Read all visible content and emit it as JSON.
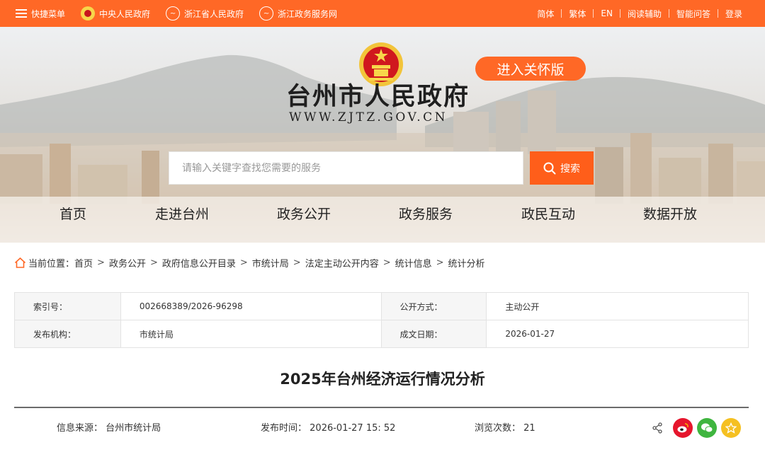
{
  "topbar": {
    "quick_menu": "快捷菜单",
    "links": [
      "中央人民政府",
      "浙江省人民政府",
      "浙江政务服务网"
    ],
    "right_links": [
      "简体",
      "繁体",
      "EN",
      "阅读辅助",
      "智能问答",
      "登录"
    ]
  },
  "banner": {
    "care_version": "进入关怀版",
    "site_title": "台州市人民政府",
    "site_url": "WWW.ZJTZ.GOV.CN",
    "search_placeholder": "请输入关键字查找您需要的服务",
    "search_button": "搜索"
  },
  "nav": [
    "首页",
    "走进台州",
    "政务公开",
    "政务服务",
    "政民互动",
    "数据开放"
  ],
  "breadcrumb": {
    "prefix": "当前位置：",
    "items": [
      "首页",
      "政务公开",
      "政府信息公开目录",
      "市统计局",
      "法定主动公开内容",
      "统计信息",
      "统计分析"
    ],
    "sep": ">"
  },
  "meta": {
    "index_label": "索引号：",
    "index_value": "002668389/2026-96298",
    "open_label": "公开方式：",
    "open_value": "主动公开",
    "org_label": "发布机构：",
    "org_value": "市统计局",
    "date_label": "成文日期：",
    "date_value": "2026-01-27"
  },
  "article": {
    "title": "2025年台州经济运行情况分析",
    "source_label": "信息来源：",
    "source_value": "台州市统计局",
    "publish_label": "发布时间：",
    "publish_value": "2026-01-27 15: 52",
    "views_label": "浏览次数：",
    "views_value": "21"
  },
  "colors": {
    "accent": "#ff6826",
    "weibo": "#e6162d",
    "wechat": "#3fb53f",
    "favorite": "#f5c021"
  },
  "icons": [
    "menu-icon",
    "national-emblem-icon",
    "zhejiang-logo-icon",
    "zhejiang-service-logo-icon",
    "search-icon",
    "home-icon",
    "share-icon",
    "weibo-icon",
    "wechat-icon",
    "favorite-icon"
  ]
}
